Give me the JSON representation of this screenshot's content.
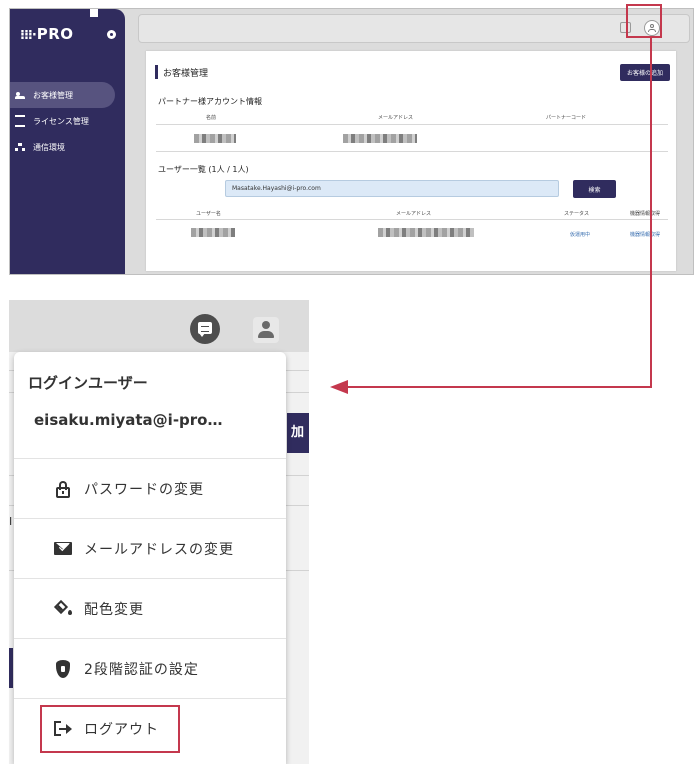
{
  "top_screenshot": {
    "logo": "PRO",
    "sidebar": {
      "items": [
        {
          "label": "お客様管理",
          "icon": "people-icon",
          "active": true
        },
        {
          "label": "ライセンス管理",
          "icon": "license-icon",
          "active": false
        },
        {
          "label": "通信環境",
          "icon": "network-icon",
          "active": false
        }
      ]
    },
    "panel": {
      "title": "お客様管理",
      "add_button": "お客様の追加",
      "partner_section": "パートナー様アカウント情報",
      "partner_headers": [
        "名前",
        "メールアドレス",
        "パートナーコード"
      ],
      "users_section": "ユーザー一覧 (1人 / 1人)",
      "search_value": "Masatake.Hayashi@i-pro.com",
      "search_button": "検索",
      "user_headers": [
        "ユーザー名",
        "メールアドレス",
        "ステータス",
        "機器情報取得"
      ],
      "user_row": {
        "status": "仮運用中",
        "device": "機器情報取得"
      }
    }
  },
  "account_menu": {
    "header": "ログインユーザー",
    "email": "eisaku.miyata@i-pro…",
    "items": [
      {
        "label": "パスワードの変更",
        "icon": "lock-icon"
      },
      {
        "label": "メールアドレスの変更",
        "icon": "mail-icon"
      },
      {
        "label": "配色変更",
        "icon": "paint-bucket-icon"
      },
      {
        "label": "2段階認証の設定",
        "icon": "shield-icon"
      },
      {
        "label": "ログアウト",
        "icon": "logout-icon"
      }
    ]
  },
  "background_fragments": {
    "right_fragment": "加",
    "left_fragment": "I"
  },
  "colors": {
    "accent": "#302c5e",
    "highlight": "#c4384d"
  }
}
